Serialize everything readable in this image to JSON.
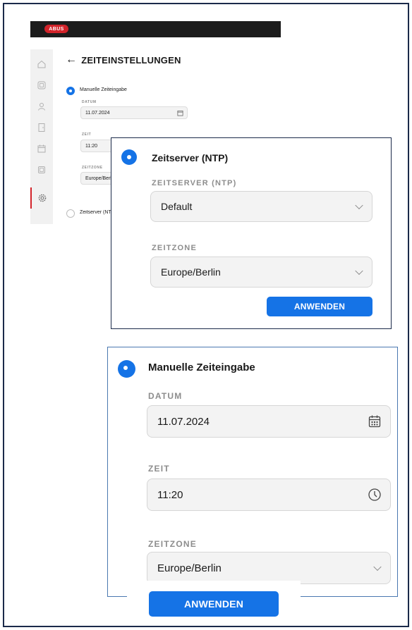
{
  "app": {
    "logo": "ABUS",
    "page_title": "ZEITEINSTELLUNGEN",
    "back_icon": "arrow-left-icon",
    "sidebar": [
      {
        "icon": "home-icon",
        "active": false
      },
      {
        "icon": "dashboard-icon",
        "active": false
      },
      {
        "icon": "user-icon",
        "active": false
      },
      {
        "icon": "door-icon",
        "active": false
      },
      {
        "icon": "calendar-icon",
        "active": false
      },
      {
        "icon": "device-icon",
        "active": false
      },
      {
        "icon": "gear-icon",
        "active": true
      }
    ],
    "manual": {
      "label": "Manuelle Zeiteingabe",
      "date_label": "DATUM",
      "date_value": "11.07.2024",
      "time_label": "ZEIT",
      "time_value": "11:20",
      "zone_label": "ZEITZONE",
      "zone_value": "Europe/Berlin"
    },
    "ntp_option": "Zeitserver (NTP)"
  },
  "ntp_panel": {
    "radio_label": "Zeitserver (NTP)",
    "server_label": "ZEITSERVER (NTP)",
    "server_value": "Default",
    "zone_label": "ZEITZONE",
    "zone_value": "Europe/Berlin",
    "apply": "ANWENDEN"
  },
  "manual_panel": {
    "radio_label": "Manuelle Zeiteingabe",
    "date_label": "DATUM",
    "date_value": "11.07.2024",
    "time_label": "ZEIT",
    "time_value": "11:20",
    "zone_label": "ZEITZONE",
    "zone_value": "Europe/Berlin",
    "apply": "ANWENDEN"
  },
  "colors": {
    "accent": "#1573e6",
    "brand": "#d2232a",
    "dark": "#1c1c1c"
  }
}
